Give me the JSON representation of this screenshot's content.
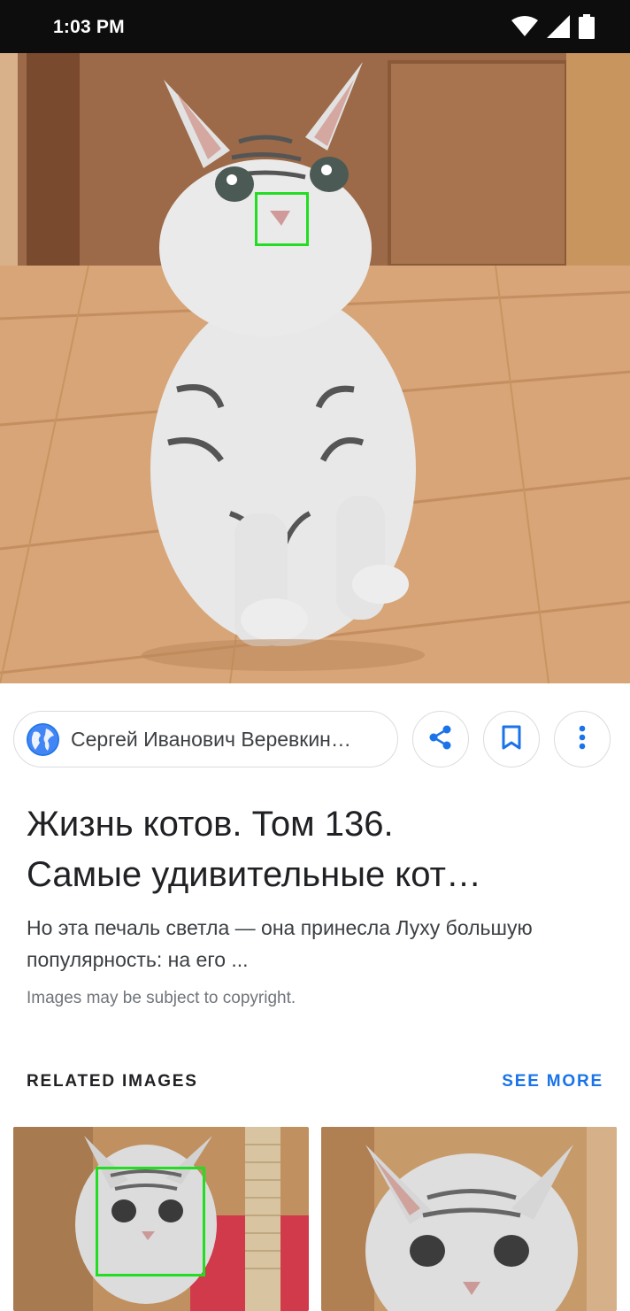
{
  "status_bar": {
    "time": "1:03 PM",
    "icons": [
      "wifi-icon",
      "signal-icon",
      "battery-icon"
    ]
  },
  "hero_image": {
    "subject": "cat-photo",
    "detection_box_color": "#22dd22"
  },
  "actions": {
    "source_name": "Сергей Иванович Веревкин…",
    "share_icon": "share-icon",
    "save_icon": "bookmark-icon",
    "more_icon": "more-vert-icon"
  },
  "result": {
    "title_line1": "Жизнь котов. Том 136.",
    "title_line2": "Самые удивительные кот…",
    "description_line1": "Но эта печаль светла — она принесла Луху большую",
    "description_line2": "популярность: на его ...",
    "copyright": "Images may be subject to copyright."
  },
  "related": {
    "header": "RELATED IMAGES",
    "see_more": "SEE MORE"
  },
  "colors": {
    "accent": "#1a73e8",
    "detection": "#22dd22",
    "status_bar": "#0d0d0d"
  }
}
